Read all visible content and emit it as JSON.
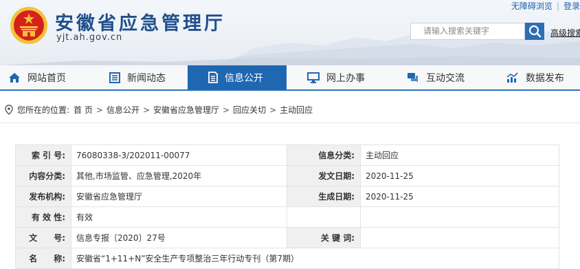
{
  "header": {
    "site_title": "安徽省应急管理厅",
    "site_domain": "yjt.ah.gov.cn",
    "top_links": [
      "无障碍浏览",
      "登录"
    ],
    "search_placeholder": "请输入搜索关键字",
    "advanced_search_label": "高级搜索"
  },
  "nav": {
    "items": [
      {
        "label": "网站首页",
        "icon": "home-icon"
      },
      {
        "label": "新闻动态",
        "icon": "news-icon"
      },
      {
        "label": "信息公开",
        "icon": "document-icon",
        "active": true
      },
      {
        "label": "网上办事",
        "icon": "monitor-icon"
      },
      {
        "label": "互动交流",
        "icon": "chat-icon"
      },
      {
        "label": "数据发布",
        "icon": "chart-icon"
      }
    ]
  },
  "breadcrumb": {
    "prefix": "您所在的位置:",
    "items": [
      "首 页",
      "信息公开",
      "安徽省应急管理厅",
      "回应关切",
      "主动回应"
    ],
    "separator": ">"
  },
  "metadata": {
    "rows": [
      {
        "l1": "索 引 号:",
        "v1": "76080338-3/202011-00077",
        "l2": "信息分类:",
        "v2": "主动回应"
      },
      {
        "l1": "内容分类:",
        "v1": "其他,市场监管、应急管理,2020年",
        "l2": "发文日期:",
        "v2": "2020-11-25"
      },
      {
        "l1": "发布机构:",
        "v1": "安徽省应急管理厅",
        "l2": "生成日期:",
        "v2": "2020-11-25"
      },
      {
        "l1": "有 效 性:",
        "v1": "有效",
        "l2": "",
        "v2": ""
      },
      {
        "l1": "文　　号:",
        "v1": "信息专报〔2020〕27号",
        "l2": "关 键 词:",
        "v2": ""
      },
      {
        "l1": "名　　称:",
        "v1": "安徽省“1+11+N”安全生产专项整治三年行动专刊（第7期）"
      }
    ]
  },
  "colors": {
    "brand_blue": "#1f67b0",
    "title_blue": "#1f4f8c",
    "emblem_red": "#d6201a",
    "emblem_gold": "#f2c23a"
  }
}
